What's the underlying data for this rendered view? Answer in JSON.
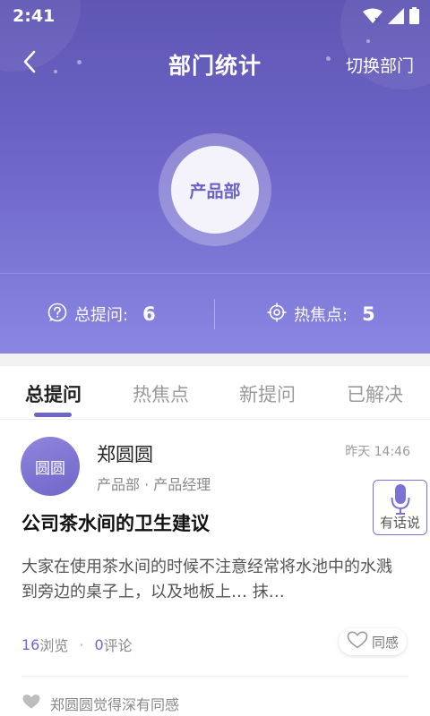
{
  "status_bar": {
    "time": "2:41"
  },
  "navbar": {
    "title": "部门统计",
    "switch_label": "切换部门"
  },
  "department": {
    "name": "产品部"
  },
  "stats": {
    "total_questions_label": "总提问:",
    "total_questions_value": "6",
    "hotspots_label": "热焦点:",
    "hotspots_value": "5"
  },
  "tabs": [
    {
      "label": "总提问",
      "active": true
    },
    {
      "label": "热焦点",
      "active": false
    },
    {
      "label": "新提问",
      "active": false
    },
    {
      "label": "已解决",
      "active": false
    }
  ],
  "post": {
    "avatar_text": "圆圆",
    "author": "郑圆圆",
    "meta": "产品部 · 产品经理",
    "time": "昨天 14:46",
    "title": "公司茶水间的卫生建议",
    "body": "大家在使用茶水间的时候不注意经常将水池中的水溅到旁边的桌子上，以及地板上… 抹…",
    "views_num": "16",
    "views_label": "浏览",
    "separator": "·",
    "comments_num": "0",
    "comments_label": "评论",
    "agree_label": "同感",
    "agree_note": "郑圆圆觉得深有同感"
  },
  "voice": {
    "label": "有话说"
  },
  "colors": {
    "accent": "#6d66c8",
    "header_top": "#5f56b3",
    "header_bottom": "#8a86e2"
  },
  "icons": [
    "back-arrow-icon",
    "wifi-icon",
    "signal-icon",
    "battery-icon",
    "question-bubble-icon",
    "target-icon",
    "heart-icon",
    "microphone-icon"
  ]
}
